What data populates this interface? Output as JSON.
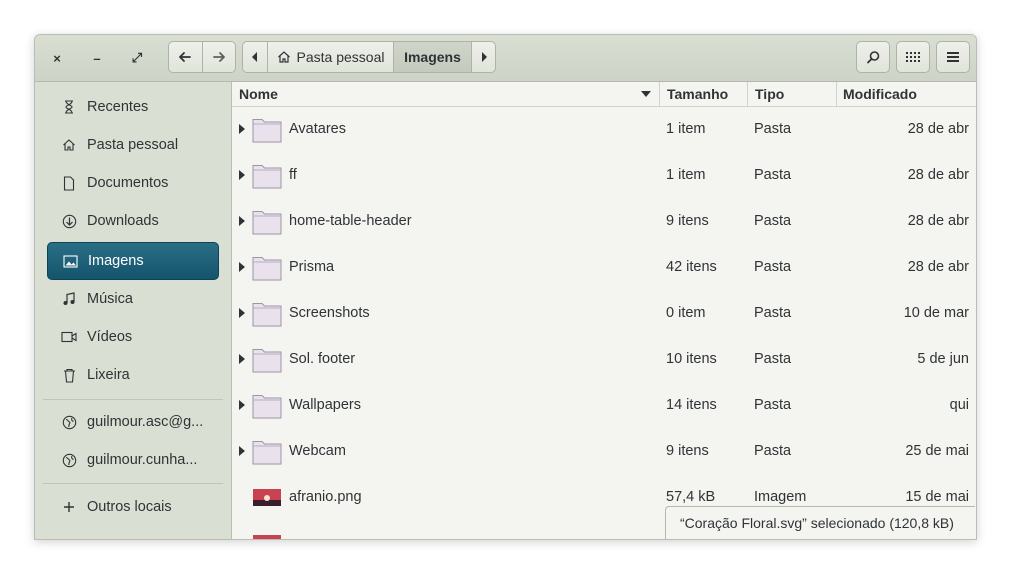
{
  "window_buttons": {
    "close": "×",
    "minimize": "–",
    "maximize": "⤢"
  },
  "nav": {
    "back_icon": "arrow-left-icon",
    "forward_icon": "arrow-right-icon"
  },
  "breadcrumb": {
    "home_label": "Pasta pessoal",
    "current_label": "Imagens"
  },
  "sidebar": {
    "items": [
      {
        "label": "Recentes",
        "icon": "clock-icon"
      },
      {
        "label": "Pasta pessoal",
        "icon": "home-icon"
      },
      {
        "label": "Documentos",
        "icon": "document-icon"
      },
      {
        "label": "Downloads",
        "icon": "download-icon"
      },
      {
        "label": "Imagens",
        "icon": "image-icon",
        "selected": true
      },
      {
        "label": "Música",
        "icon": "music-icon"
      },
      {
        "label": "Vídeos",
        "icon": "video-icon"
      },
      {
        "label": "Lixeira",
        "icon": "trash-icon"
      }
    ],
    "network": [
      {
        "label": "guilmour.asc@g...",
        "icon": "globe-icon"
      },
      {
        "label": "guilmour.cunha...",
        "icon": "globe-icon"
      }
    ],
    "other_label": "Outros locais"
  },
  "columns": {
    "name": "Nome",
    "size": "Tamanho",
    "type": "Tipo",
    "modified": "Modificado"
  },
  "files": [
    {
      "name": "Avatares",
      "size": "1 item",
      "type": "Pasta",
      "modified": "28 de abr",
      "kind": "folder"
    },
    {
      "name": "ff",
      "size": "1 item",
      "type": "Pasta",
      "modified": "28 de abr",
      "kind": "folder"
    },
    {
      "name": "home-table-header",
      "size": "9 itens",
      "type": "Pasta",
      "modified": "28 de abr",
      "kind": "folder"
    },
    {
      "name": "Prisma",
      "size": "42 itens",
      "type": "Pasta",
      "modified": "28 de abr",
      "kind": "folder"
    },
    {
      "name": "Screenshots",
      "size": "0 item",
      "type": "Pasta",
      "modified": "10 de mar",
      "kind": "folder"
    },
    {
      "name": "Sol. footer",
      "size": "10 itens",
      "type": "Pasta",
      "modified": "5 de jun",
      "kind": "folder"
    },
    {
      "name": "Wallpapers",
      "size": "14 itens",
      "type": "Pasta",
      "modified": "qui",
      "kind": "folder"
    },
    {
      "name": "Webcam",
      "size": "9 itens",
      "type": "Pasta",
      "modified": "25 de mai",
      "kind": "folder"
    },
    {
      "name": "afranio.png",
      "size": "57,4 kB",
      "type": "Imagem",
      "modified": "15 de mai",
      "kind": "image"
    }
  ],
  "status_text": "“Coração Floral.svg” selecionado (120,8 kB)",
  "colors": {
    "accent": "#1a5d75",
    "header_bg": "#d3dacd",
    "sidebar_bg": "#d9e0d3",
    "folder": "#e6dfea"
  }
}
